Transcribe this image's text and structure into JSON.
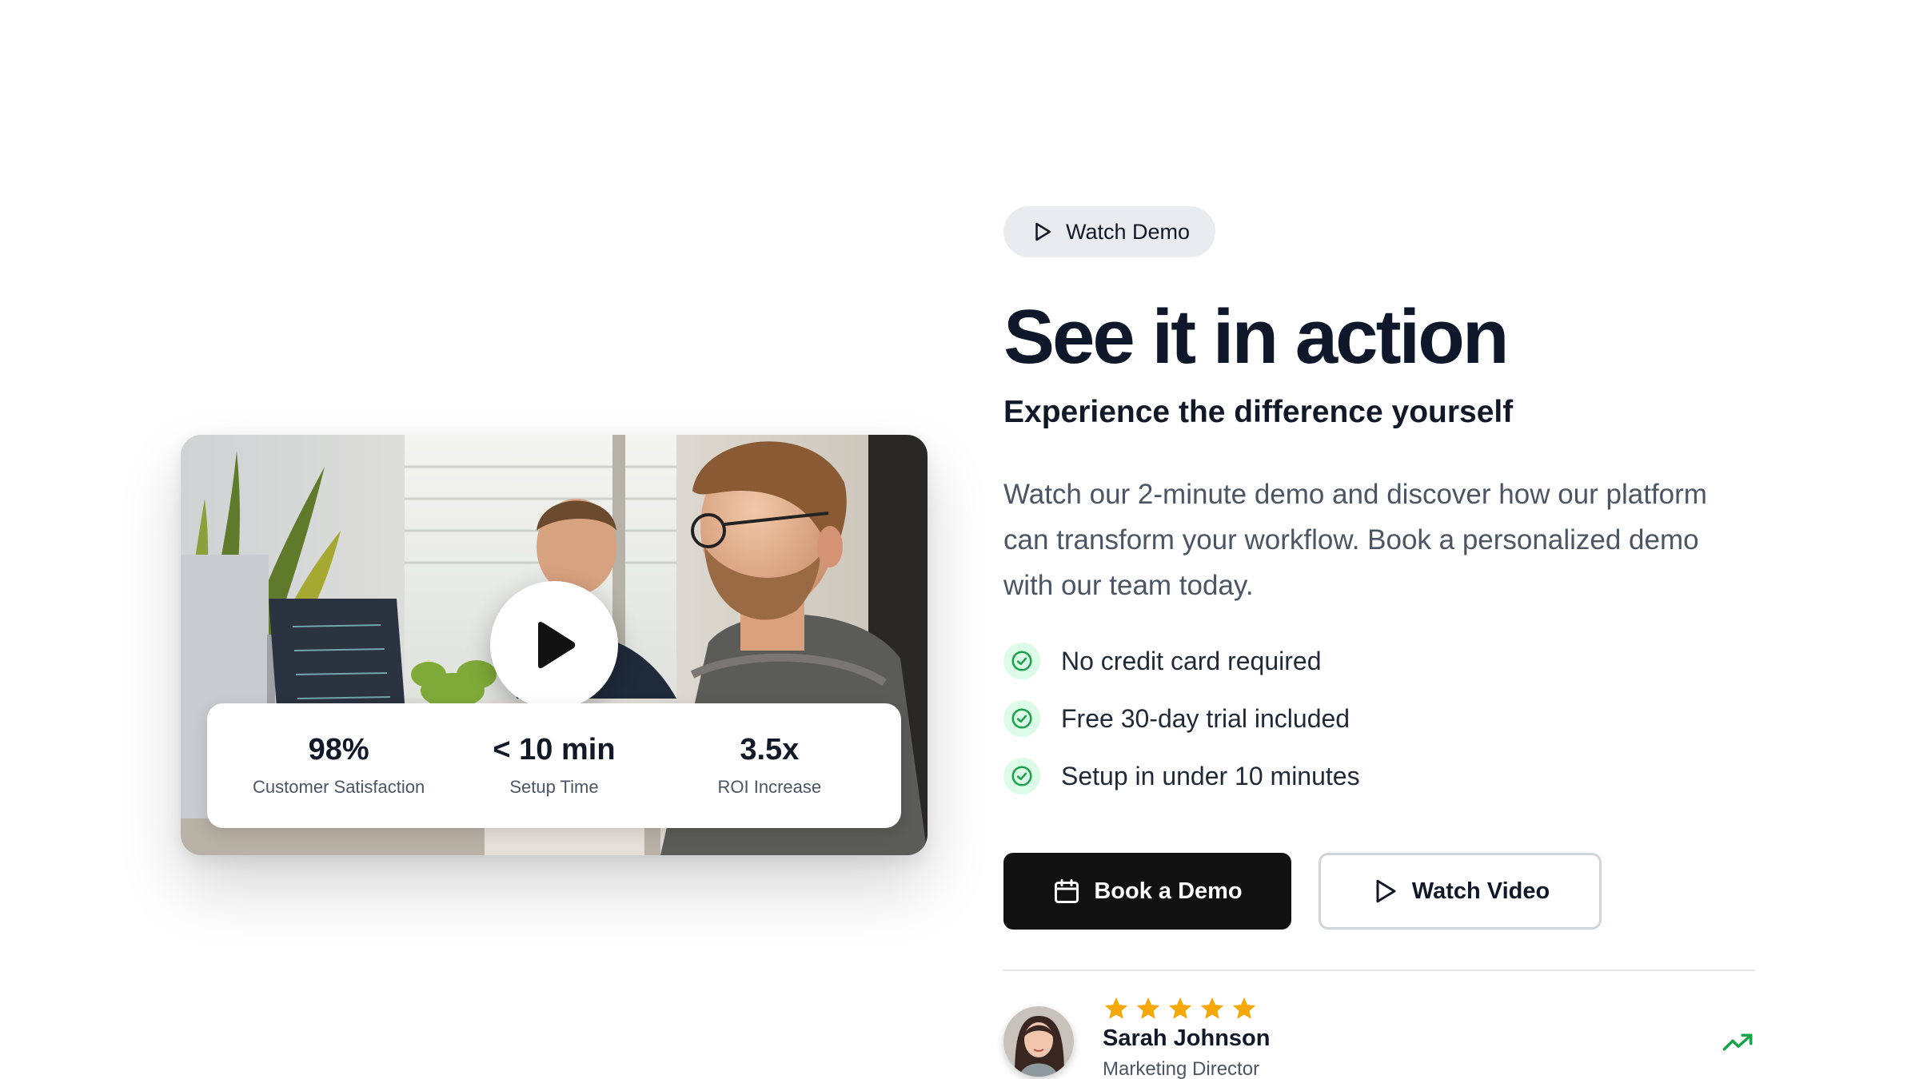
{
  "badge": {
    "label": "Watch Demo",
    "icon": "play-icon"
  },
  "hero": {
    "headline": "See it in action",
    "subheadline": "Experience the difference yourself",
    "description": "Watch our 2-minute demo and discover how our platform can transform your workflow. Book a personalized demo with our team today."
  },
  "features": [
    {
      "text": "No credit card required",
      "icon": "check-circle-icon"
    },
    {
      "text": "Free 30-day trial included",
      "icon": "check-circle-icon"
    },
    {
      "text": "Setup in under 10 minutes",
      "icon": "check-circle-icon"
    }
  ],
  "cta": {
    "primary": {
      "label": "Book a Demo",
      "icon": "calendar-icon"
    },
    "secondary": {
      "label": "Watch Video",
      "icon": "play-icon"
    }
  },
  "video": {
    "play_icon": "play-icon",
    "stats": [
      {
        "value": "98%",
        "label": "Customer Satisfaction"
      },
      {
        "value": "< 10 min",
        "label": "Setup Time"
      },
      {
        "value": "3.5x",
        "label": "ROI Increase"
      }
    ]
  },
  "testimonial": {
    "rating": 5,
    "name": "Sarah Johnson",
    "role": "Marketing Director",
    "trend_icon": "trending-up-icon"
  },
  "colors": {
    "primary_button": "#111111",
    "accent_green": "#16a34a",
    "check_bg": "#dcfce7",
    "star": "#f5a80b",
    "badge_bg": "#e9ebee"
  }
}
